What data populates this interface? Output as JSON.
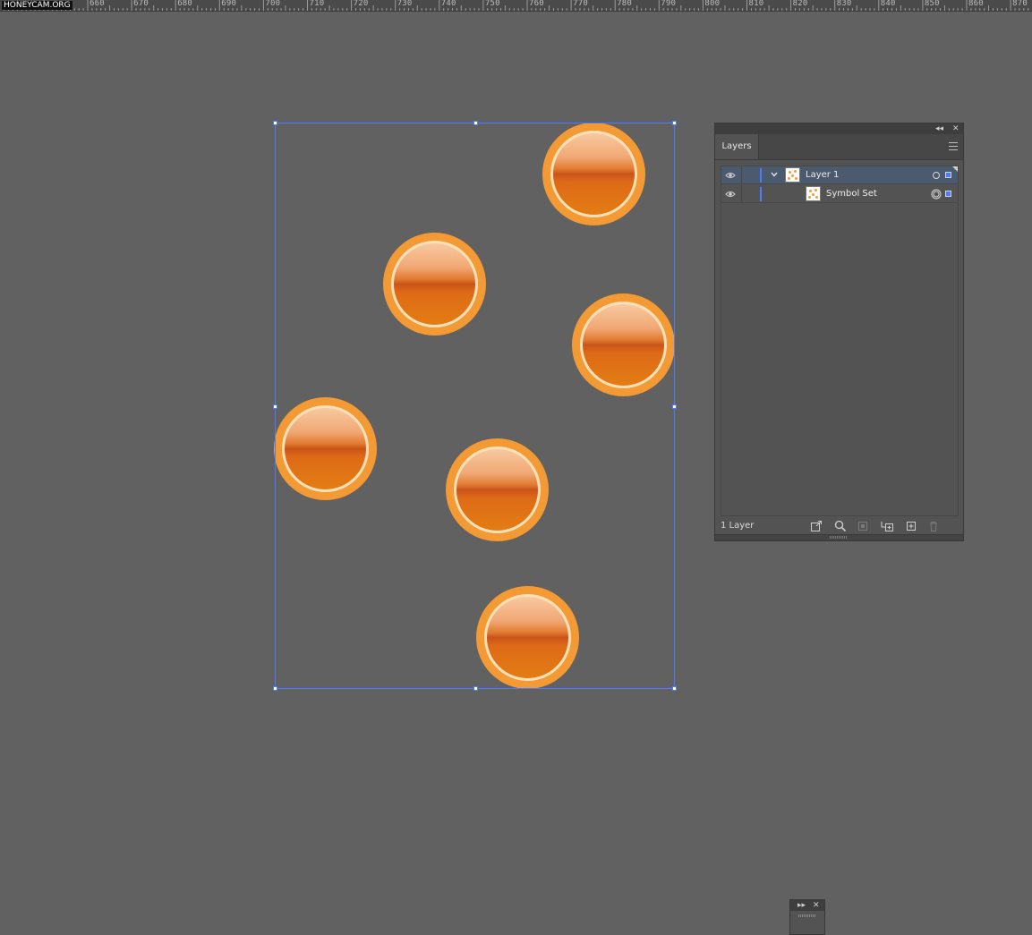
{
  "watermark": "HONEYCAM.ORG",
  "ruler": {
    "labels": [
      "660",
      "670",
      "680",
      "690",
      "700",
      "710",
      "720",
      "730",
      "740",
      "750",
      "760",
      "770",
      "780",
      "790",
      "800",
      "810",
      "820",
      "830",
      "840",
      "850",
      "860",
      "870"
    ]
  },
  "layers_panel": {
    "collapse_glyph": "◂◂",
    "close_glyph": "✕",
    "tab_label": "Layers",
    "rows": [
      {
        "name": "Layer 1",
        "selected": true
      },
      {
        "name": "Symbol Set",
        "selected": false
      }
    ],
    "footer_count": "1 Layer",
    "accent_color": "#4f7cff"
  },
  "mini_panel": {
    "expand_glyph": "▸▸",
    "close_glyph": "✕"
  },
  "orbs": {
    "count": 6,
    "outer_color": "#f39a35",
    "ring_color": "#fde0b8"
  }
}
